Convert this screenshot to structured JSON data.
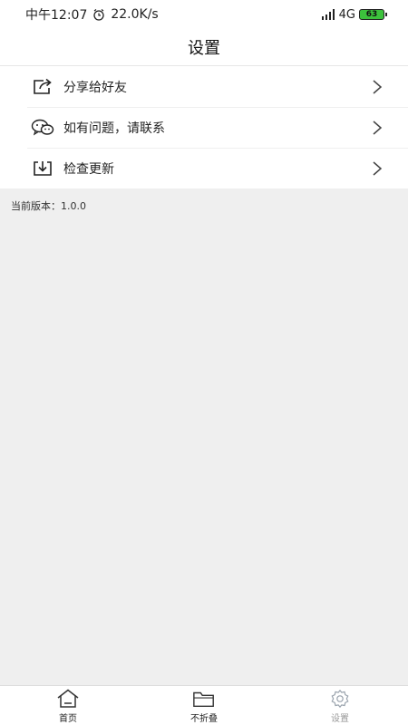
{
  "status_bar": {
    "time": "中午12:07",
    "net_speed": "22.0K/s",
    "network": "4G",
    "battery": "63"
  },
  "header": {
    "title": "设置"
  },
  "menu": {
    "items": [
      {
        "label": "分享给好友",
        "icon": "share-icon"
      },
      {
        "label": "如有问题，请联系",
        "icon": "wechat-icon"
      },
      {
        "label": "检查更新",
        "icon": "download-icon"
      }
    ]
  },
  "version": {
    "text": "当前版本：1.0.0"
  },
  "tabs": [
    {
      "label": "首页",
      "icon": "home-icon",
      "active": false
    },
    {
      "label": "不折叠",
      "icon": "folder-icon",
      "active": false
    },
    {
      "label": "设置",
      "icon": "gear-icon",
      "active": true
    }
  ],
  "colors": {
    "background": "#ffffff",
    "content_gray": "#efefef",
    "active_tab": "#999999",
    "battery_fill": "#3cc23c"
  }
}
